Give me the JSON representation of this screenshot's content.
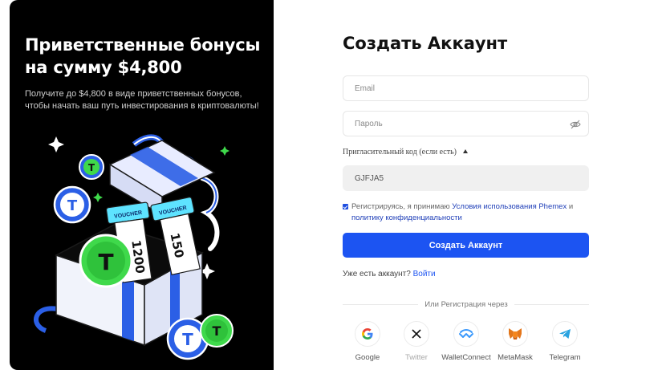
{
  "promo": {
    "heading": "Приветственные бонусы на сумму $4,800",
    "subtext": "Получите до $4,800 в виде приветственных бонусов, чтобы начать ваш путь инвестирования в криптовалюты!",
    "voucher_label": "VOUCHER",
    "voucher_values": [
      "1200",
      "150"
    ]
  },
  "form": {
    "title": "Создать Аккаунт",
    "email_placeholder": "Email",
    "password_placeholder": "Пароль",
    "invite_label": "Пригласительный код (если есть)",
    "invite_code": "GJFJA5",
    "agree_prefix": "Регистрируясь, я принимаю ",
    "terms_link": "Условия использования Phemex",
    "agree_and": " и",
    "privacy_link": "политику конфиденциальности",
    "submit_label": "Создать Аккаунт",
    "have_account": "Уже есть аккаунт?",
    "login_link": "Войти",
    "divider_text": "Или Регистрация через"
  },
  "social": [
    {
      "label": "Google",
      "icon": "google-icon"
    },
    {
      "label": "Twitter",
      "icon": "x-icon"
    },
    {
      "label": "WalletConnect",
      "icon": "walletconnect-icon"
    },
    {
      "label": "MetaMask",
      "icon": "metamask-icon"
    },
    {
      "label": "Telegram",
      "icon": "telegram-icon"
    }
  ],
  "colors": {
    "accent": "#1c54f2",
    "link": "#1f3fb8",
    "panel_bg": "#000000",
    "coin_green": "#3fd94b",
    "coin_blue": "#2b5fe6"
  }
}
